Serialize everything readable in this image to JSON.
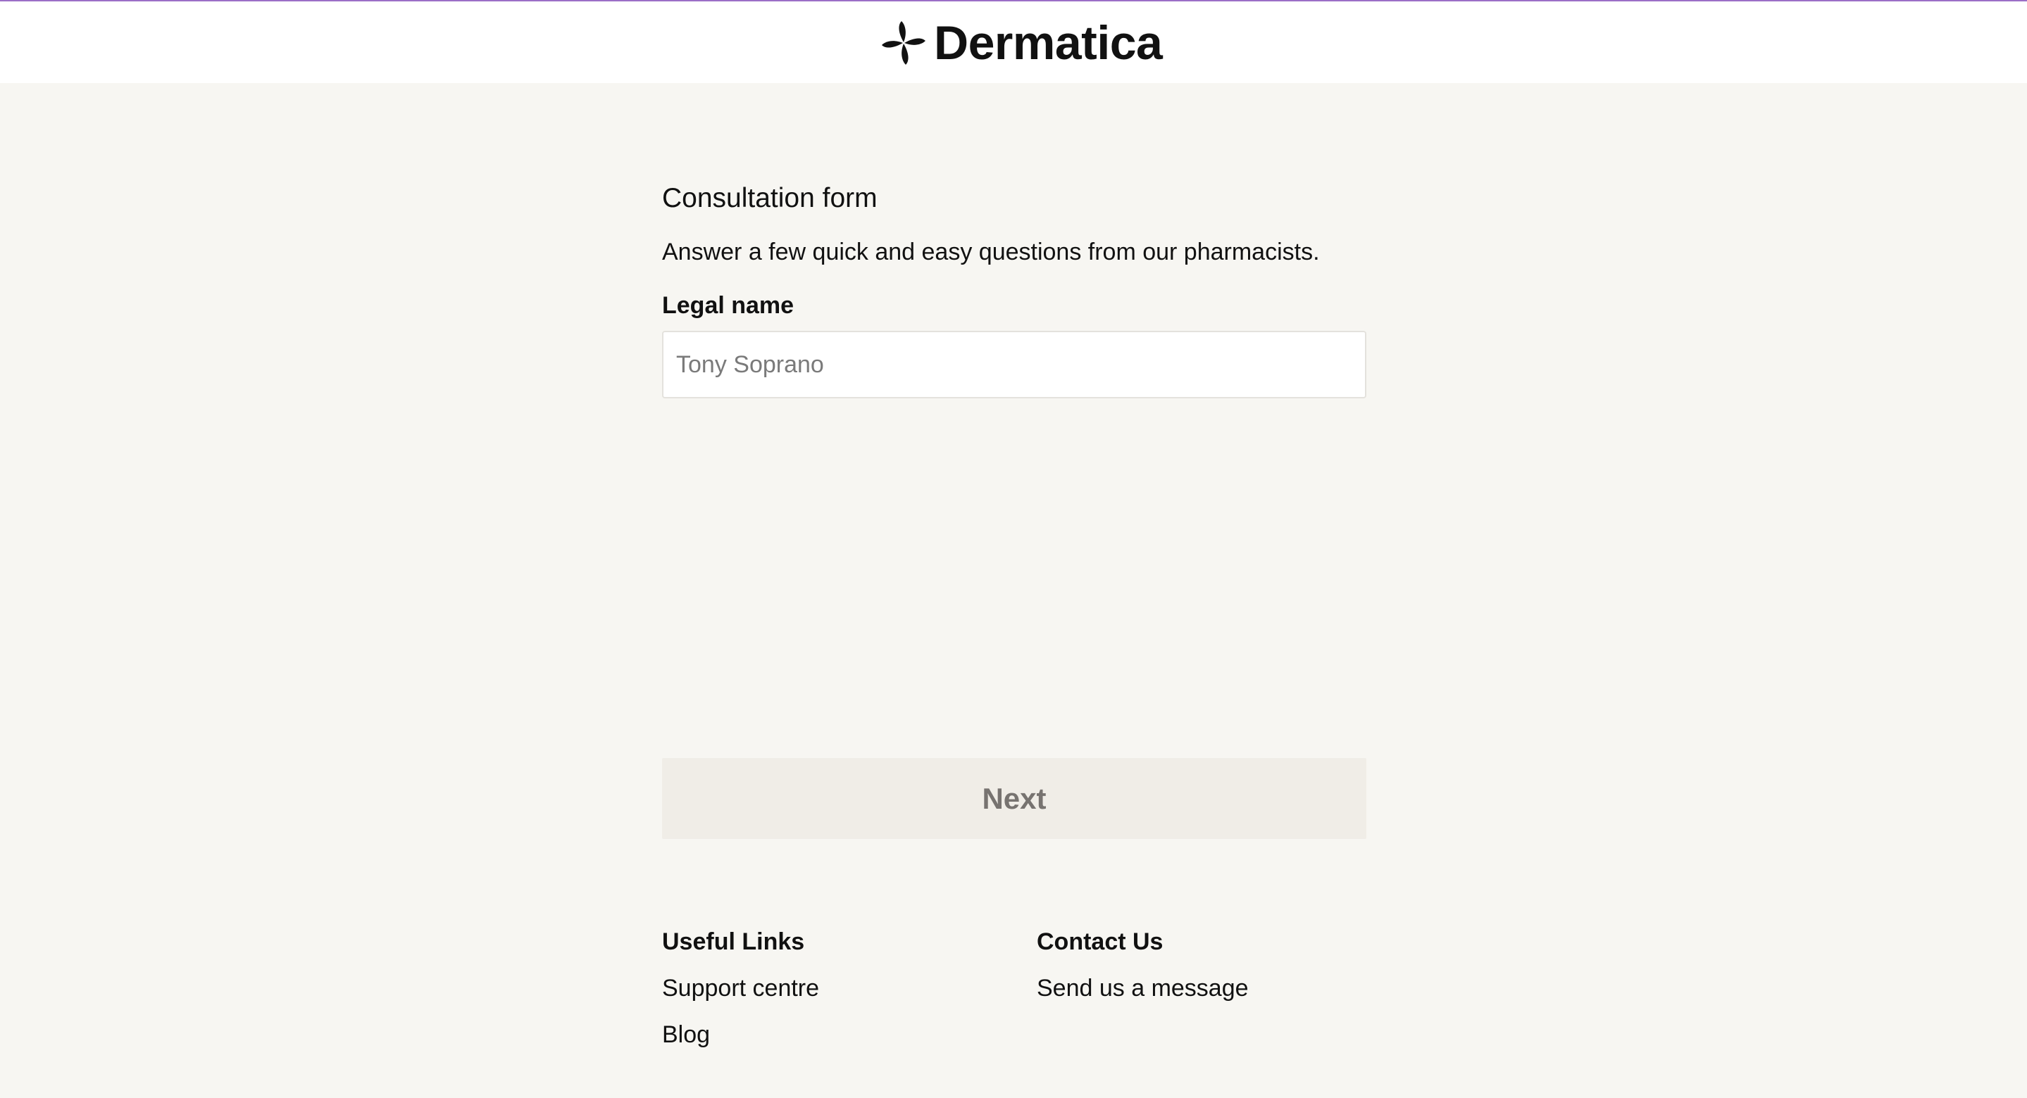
{
  "brand": {
    "name": "Dermatica",
    "logo_icon": "pinwheel-logo-icon"
  },
  "form": {
    "title": "Consultation form",
    "subtitle": "Answer a few quick and easy questions from our pharmacists.",
    "fields": {
      "legal_name": {
        "label": "Legal name",
        "value": "",
        "placeholder": "Tony Soprano"
      }
    },
    "next_label": "Next"
  },
  "footer": {
    "useful_links": {
      "heading": "Useful Links",
      "links": [
        "Support centre",
        "Blog"
      ]
    },
    "contact": {
      "heading": "Contact Us",
      "links": [
        "Send us a message"
      ]
    }
  },
  "colors": {
    "background": "#f7f6f2",
    "header_background": "#ffffff",
    "top_accent": "#9b6fc7",
    "button_disabled_background": "#f0ede7",
    "button_disabled_text": "#777370"
  }
}
